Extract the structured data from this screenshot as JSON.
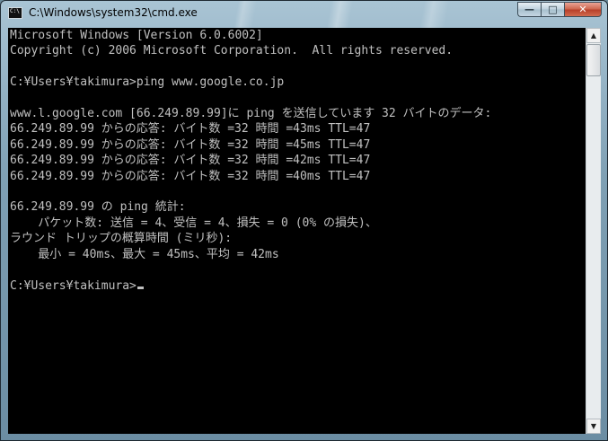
{
  "window": {
    "title": "C:\\Windows\\system32\\cmd.exe",
    "icon_label": "C:\\"
  },
  "controls": {
    "minimize_icon": "minimize-icon",
    "maximize_icon": "maximize-icon",
    "close_icon": "close-icon",
    "minimize_glyph": "—",
    "maximize_glyph": "□",
    "close_glyph": "✕"
  },
  "console": {
    "lines": [
      "Microsoft Windows [Version 6.0.6002]",
      "Copyright (c) 2006 Microsoft Corporation.  All rights reserved.",
      "",
      "C:¥Users¥takimura>ping www.google.co.jp",
      "",
      "www.l.google.com [66.249.89.99]に ping を送信しています 32 バイトのデータ:",
      "66.249.89.99 からの応答: バイト数 =32 時間 =43ms TTL=47",
      "66.249.89.99 からの応答: バイト数 =32 時間 =45ms TTL=47",
      "66.249.89.99 からの応答: バイト数 =32 時間 =42ms TTL=47",
      "66.249.89.99 からの応答: バイト数 =32 時間 =40ms TTL=47",
      "",
      "66.249.89.99 の ping 統計:",
      "    パケット数: 送信 = 4、受信 = 4、損失 = 0 (0% の損失)、",
      "ラウンド トリップの概算時間 (ミリ秒):",
      "    最小 = 40ms、最大 = 45ms、平均 = 42ms",
      ""
    ],
    "prompt": "C:¥Users¥takimura>"
  },
  "scrollbar": {
    "up_glyph": "▲",
    "down_glyph": "▼"
  }
}
